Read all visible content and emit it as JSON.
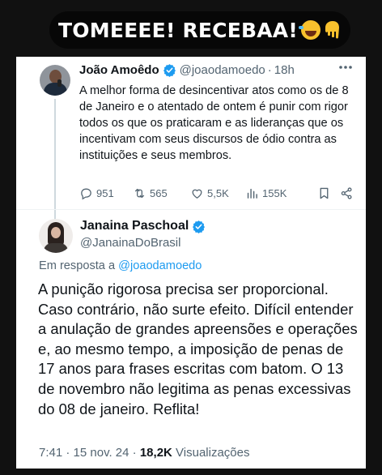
{
  "banner": {
    "text": "TOMEEEE! RECEBAA!",
    "emojis": [
      "rolling-on-floor-laughing-icon",
      "backhand-index-pointing-down-icon"
    ]
  },
  "colors": {
    "accent": "#1d9bf0",
    "text_primary": "#0f1419",
    "text_secondary": "#536471",
    "page_background": "#111111",
    "banner_background": "#070707"
  },
  "quoted_tweet": {
    "author_name": "João Amoêdo",
    "verified": true,
    "handle": "@joaodamoedo",
    "separator": "·",
    "time": "18h",
    "text": "A melhor forma de desincentivar atos como os de 8 de Janeiro e o atentado de ontem é punir com rigor todos os que os praticaram e as lideranças que os incentivam com seus discursos de ódio contra as instituições e seus membros.",
    "replies": "951",
    "retweets": "565",
    "likes": "5,5K",
    "views": "155K"
  },
  "main_tweet": {
    "author_name": "Janaina Paschoal",
    "verified": true,
    "handle": "@JanainaDoBrasil",
    "reply_prefix": "Em resposta a",
    "reply_mention": "@joaodamoedo",
    "text": "A punição rigorosa precisa ser proporcional. Caso contrário, não surte efeito. Difícil entender a anulação de grandes apreensões e operações e, ao mesmo tempo, a imposição de penas de 17 anos para frases escritas com batom. O 13 de novembro não legitima as penas excessivas do 08 de janeiro. Reflita!",
    "time": "7:41",
    "separator": "·",
    "date": "15 nov. 24",
    "separator2": "·",
    "views_count": "18,2K",
    "views_label": "Visualizações"
  }
}
